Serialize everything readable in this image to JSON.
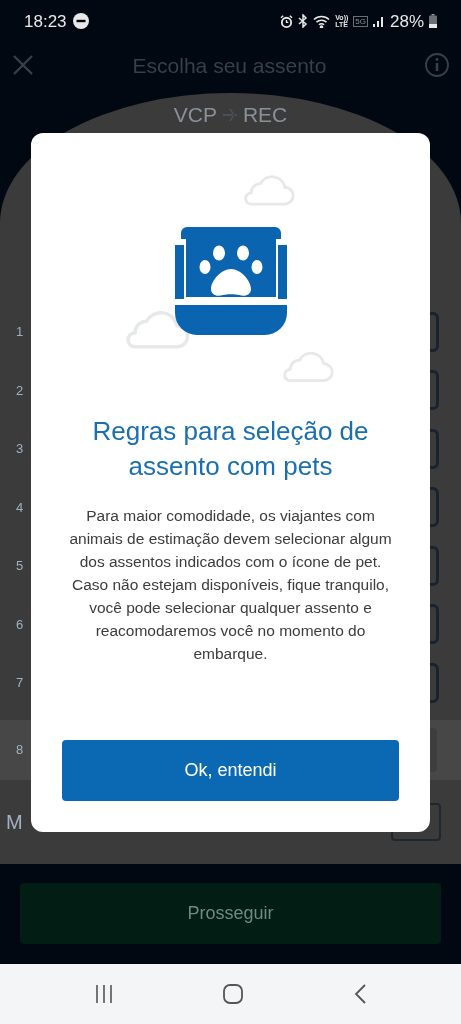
{
  "status_bar": {
    "time": "18:23",
    "volte": [
      "Vo))",
      "LTE"
    ],
    "network": "5G",
    "battery": "28%"
  },
  "header": {
    "title": "Escolha seu assento"
  },
  "route": {
    "origin": "VCP",
    "destination": "REC"
  },
  "seat_rows": [
    {
      "number": "1"
    },
    {
      "number": "2"
    },
    {
      "number": "3"
    },
    {
      "number": "4"
    },
    {
      "number": "5"
    },
    {
      "number": "6"
    },
    {
      "number": "7"
    },
    {
      "number": "8"
    }
  ],
  "legend": {
    "label": "M"
  },
  "proceed_button": {
    "label": "Prosseguir",
    "disabled": true
  },
  "dialog": {
    "title": "Regras para seleção de assento com pets",
    "body": "Para maior comodidade, os viajantes com animais de estimação devem selecionar algum dos assentos indicados com o ícone de pet. Caso não estejam disponíveis, fique tranquilo, você pode selecionar qualquer assento e reacomodaremos você no momento do embarque.",
    "button": "Ok, entendi"
  }
}
